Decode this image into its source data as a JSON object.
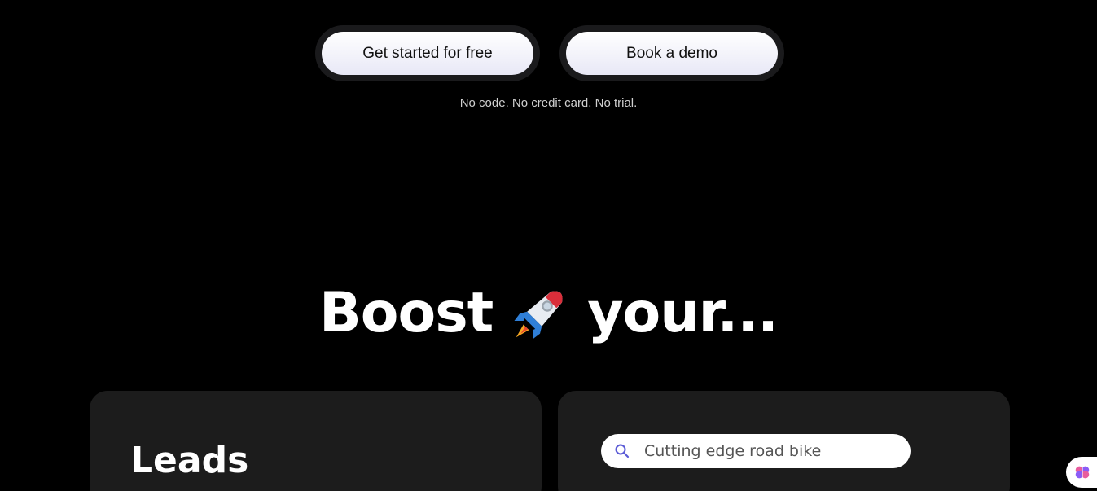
{
  "cta": {
    "primary_label": "Get started for free",
    "secondary_label": "Book a demo",
    "note": "No code. No credit card. No trial."
  },
  "hero": {
    "headline_before": "Boost",
    "headline_icon": "rocket-emoji",
    "headline_after": "your..."
  },
  "cards": {
    "left_title": "Leads",
    "right_search_value": "Cutting edge road bike",
    "right_search_icon": "search-icon"
  },
  "widget": {
    "icon": "brain-icon"
  },
  "colors": {
    "background": "#000000",
    "card": "#1c1c1c",
    "search_icon": "#5b5bd6"
  }
}
